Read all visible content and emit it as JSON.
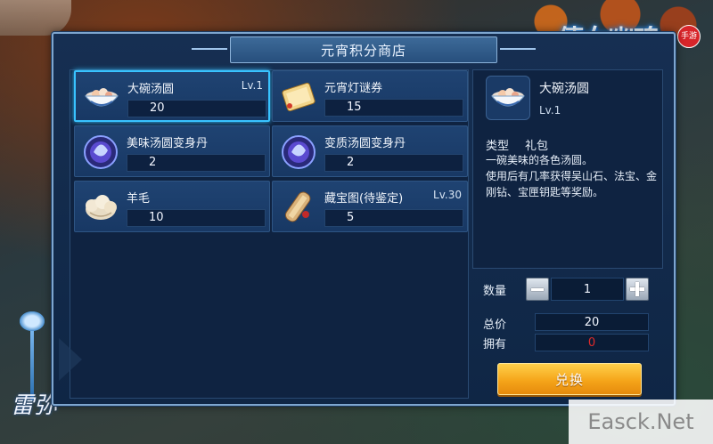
{
  "game": {
    "logo_text": "倩女幽魂",
    "logo_seal": "手游",
    "signature": "雷弥"
  },
  "shop": {
    "title": "元宵积分商店",
    "items": [
      {
        "name": "大碗汤圆",
        "level": "Lv.1",
        "price": "20",
        "icon": "rice-ball-bowl-icon",
        "selected": true
      },
      {
        "name": "元宵灯谜券",
        "level": "",
        "price": "15",
        "icon": "riddle-ticket-icon",
        "selected": false
      },
      {
        "name": "美味汤圆变身丹",
        "level": "",
        "price": "2",
        "icon": "transform-pill-icon",
        "selected": false
      },
      {
        "name": "变质汤圆变身丹",
        "level": "",
        "price": "2",
        "icon": "transform-pill-icon",
        "selected": false
      },
      {
        "name": "羊毛",
        "level": "",
        "price": "10",
        "icon": "wool-icon",
        "selected": false
      },
      {
        "name": "藏宝图(待鉴定)",
        "level": "Lv.30",
        "price": "5",
        "icon": "treasure-map-icon",
        "selected": false
      }
    ]
  },
  "detail": {
    "name": "大碗汤圆",
    "level": "Lv.1",
    "type_label": "类型",
    "type_value": "礼包",
    "description_line1": "一碗美味的各色汤圆。",
    "description_line2": "使用后有几率获得吴山石、法宝、金刚钻、宝匣钥匙等奖励。"
  },
  "purchase": {
    "quantity_label": "数量",
    "quantity": "1",
    "total_label": "总价",
    "total": "20",
    "owned_label": "拥有",
    "owned": "0",
    "exchange_label": "兑换"
  },
  "colors": {
    "owned_value": "#e02a2a",
    "selected_border": "#38c3ff",
    "button_gradient_top": "#ffd04a"
  },
  "watermark": "Easck.Net"
}
